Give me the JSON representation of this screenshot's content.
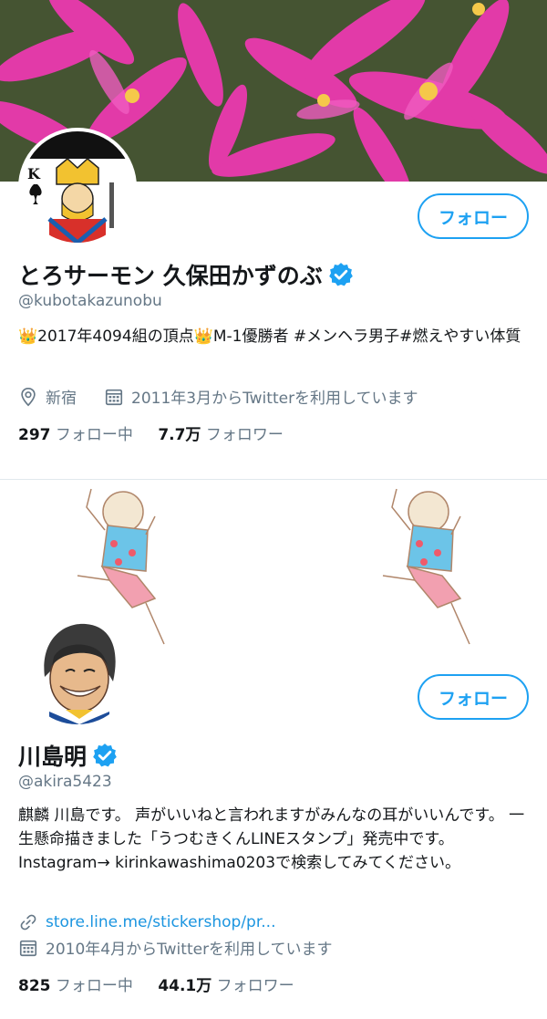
{
  "profiles": [
    {
      "display_name": "とろサーモン 久保田かずのぶ",
      "handle": "@kubotakazunobu",
      "bio": "👑2017年4094組の頂点👑M-1優勝者 #メンヘラ男子#燃えやすい体質",
      "location": "新宿",
      "joined": "2011年3月からTwitterを利用しています",
      "following_count": "297",
      "following_label": "フォロー中",
      "followers_count": "7.7万",
      "followers_label": "フォロワー",
      "follow_button": "フォロー"
    },
    {
      "display_name": "川島明",
      "handle": "@akira5423",
      "bio": "麒麟 川島です。 声がいいねと言われますがみんなの耳がいいんです。 一生懸命描きました「うつむきくんLINEスタンプ」発売中です。 Instagram→ kirinkawashima0203で検索してみてください。",
      "website": "store.line.me/stickershop/pr...",
      "joined": "2010年4月からTwitterを利用しています",
      "following_count": "825",
      "following_label": "フォロー中",
      "followers_count": "44.1万",
      "followers_label": "フォロワー",
      "follow_button": "フォロー"
    }
  ],
  "colors": {
    "accent": "#1da1f2",
    "link": "#1b95e0",
    "muted": "#657786",
    "text": "#14171a"
  },
  "icons": [
    "verified-badge-icon",
    "location-pin-icon",
    "calendar-icon",
    "link-icon"
  ]
}
